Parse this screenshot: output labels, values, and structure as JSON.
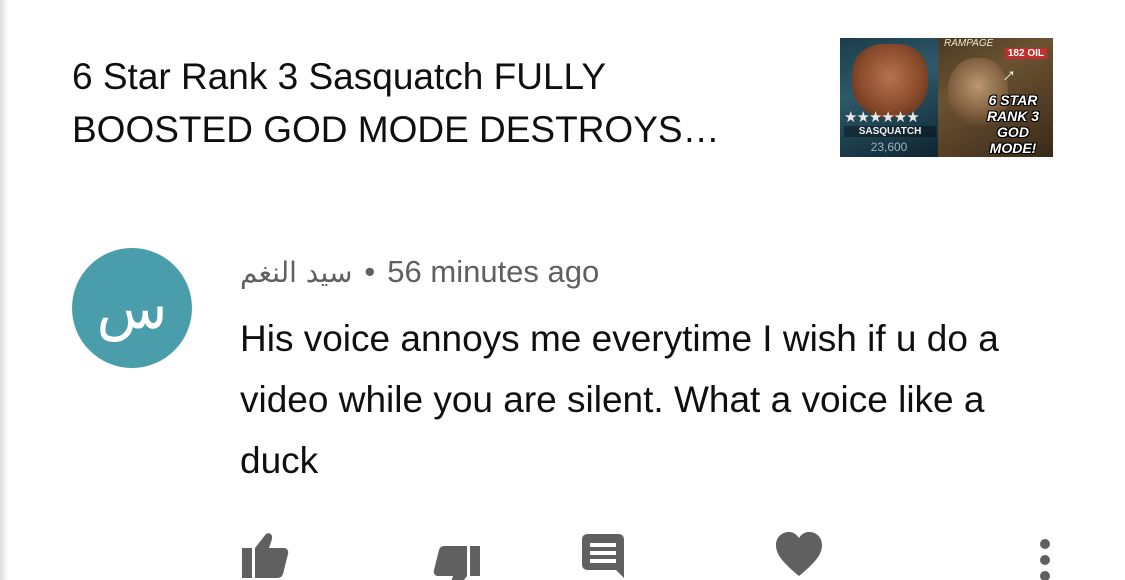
{
  "video": {
    "title": "6 Star Rank 3 Sasquatch FULLY BOOSTED GOD MODE DESTROYS…",
    "thumbnail": {
      "top_text": "RAMPAGE",
      "oil_badge": "182 OIL",
      "champion_name": "SASQUATCH",
      "rating": "23,600",
      "stars": "★★★★★★",
      "promo_text": "6 STAR RANK 3 GOD MODE!"
    }
  },
  "comment": {
    "avatar_letter": "س",
    "avatar_color": "#4a9dab",
    "author": "سيد النغم",
    "separator": "•",
    "time": "56 minutes ago",
    "text": "His voice annoys me everytime I wish if u do a video while you are silent. What a voice like a duck"
  },
  "actions": {
    "icons": [
      "thumbs-up-icon",
      "thumbs-down-icon",
      "reply-icon",
      "heart-icon",
      "more-vert-icon"
    ]
  }
}
